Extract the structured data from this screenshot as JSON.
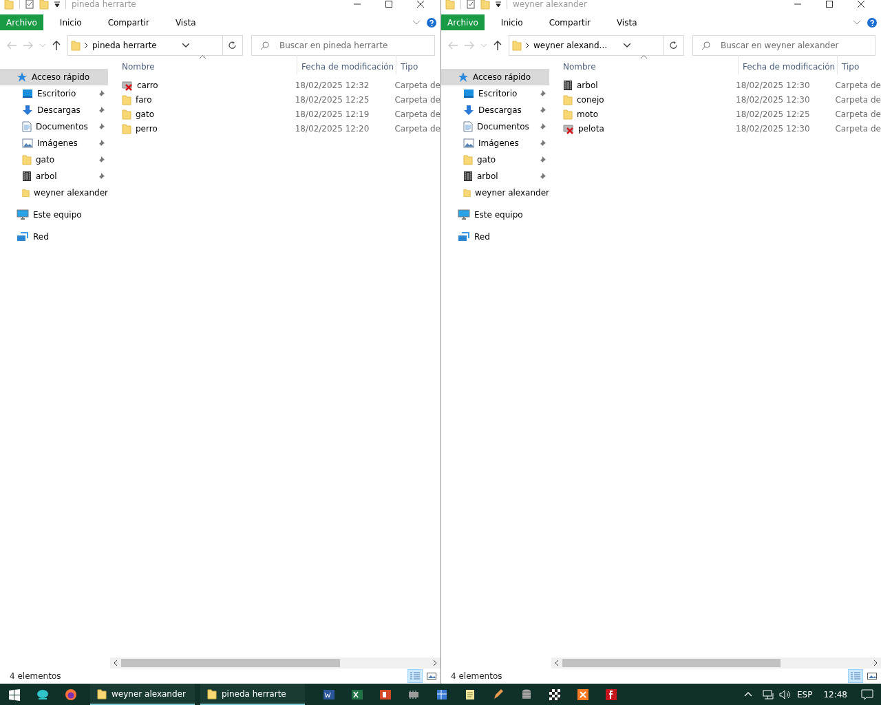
{
  "windows": [
    {
      "title": "pineda herrarte",
      "ribbon_tabs": [
        {
          "label": "Archivo",
          "kind": "file"
        },
        {
          "label": "Inicio",
          "kind": "tab"
        },
        {
          "label": "Compartir",
          "kind": "tab"
        },
        {
          "label": "Vista",
          "kind": "tab"
        }
      ],
      "address": "pineda herrarte",
      "search": {
        "placeholder": "Buscar en pineda herrarte"
      },
      "nav": [
        {
          "label": "Acceso rápido",
          "kind": "star",
          "selected": true,
          "children": [
            {
              "label": "Escritorio",
              "kind": "desktop",
              "pinned": true,
              "selected": false
            },
            {
              "label": "Descargas",
              "kind": "download",
              "pinned": true,
              "selected": false
            },
            {
              "label": "Documentos",
              "kind": "documents",
              "pinned": true,
              "selected": false
            },
            {
              "label": "Imágenes",
              "kind": "pictures",
              "pinned": true,
              "selected": false
            },
            {
              "label": "gato",
              "kind": "folder",
              "pinned": true,
              "selected": false
            },
            {
              "label": "arbol",
              "kind": "film",
              "pinned": true,
              "selected": false
            },
            {
              "label": "weyner alexander",
              "kind": "folder",
              "pinned": false,
              "selected": false
            }
          ]
        },
        {
          "label": "Este equipo",
          "kind": "computer",
          "selected": false
        },
        {
          "label": "Red",
          "kind": "network",
          "selected": false
        }
      ],
      "columns": [
        {
          "label": "Nombre",
          "sorted": true
        },
        {
          "label": "Fecha de modificación",
          "sorted": false
        },
        {
          "label": "Tipo",
          "sorted": false
        }
      ],
      "files": [
        {
          "name": "carro",
          "kind": "folder-x",
          "date": "18/02/2025 12:32",
          "type": "Carpeta de",
          "selected": false
        },
        {
          "name": "faro",
          "kind": "folder",
          "date": "18/02/2025 12:25",
          "type": "Carpeta de",
          "selected": false
        },
        {
          "name": "gato",
          "kind": "folder",
          "date": "18/02/2025 12:19",
          "type": "Carpeta de",
          "selected": false
        },
        {
          "name": "perro",
          "kind": "folder",
          "date": "18/02/2025 12:20",
          "type": "Carpeta de",
          "selected": false
        }
      ],
      "status": "4 elementos",
      "views": [
        {
          "kind": "details",
          "selected": true
        },
        {
          "kind": "tiles",
          "selected": false
        }
      ]
    },
    {
      "title": "weyner alexander",
      "ribbon_tabs": [
        {
          "label": "Archivo",
          "kind": "file"
        },
        {
          "label": "Inicio",
          "kind": "tab"
        },
        {
          "label": "Compartir",
          "kind": "tab"
        },
        {
          "label": "Vista",
          "kind": "tab"
        }
      ],
      "address": "weyner alexand...",
      "search": {
        "placeholder": "Buscar en weyner alexander"
      },
      "nav": [
        {
          "label": "Acceso rápido",
          "kind": "star",
          "selected": true,
          "children": [
            {
              "label": "Escritorio",
              "kind": "desktop",
              "pinned": true,
              "selected": false
            },
            {
              "label": "Descargas",
              "kind": "download",
              "pinned": true,
              "selected": false
            },
            {
              "label": "Documentos",
              "kind": "documents",
              "pinned": true,
              "selected": false
            },
            {
              "label": "Imágenes",
              "kind": "pictures",
              "pinned": true,
              "selected": false
            },
            {
              "label": "gato",
              "kind": "folder",
              "pinned": true,
              "selected": false
            },
            {
              "label": "arbol",
              "kind": "film",
              "pinned": true,
              "selected": false
            },
            {
              "label": "weyner alexander",
              "kind": "folder",
              "pinned": false,
              "selected": false
            }
          ]
        },
        {
          "label": "Este equipo",
          "kind": "computer",
          "selected": false
        },
        {
          "label": "Red",
          "kind": "network",
          "selected": false
        }
      ],
      "columns": [
        {
          "label": "Nombre",
          "sorted": true
        },
        {
          "label": "Fecha de modificación",
          "sorted": false
        },
        {
          "label": "Tipo",
          "sorted": false
        }
      ],
      "files": [
        {
          "name": "arbol",
          "kind": "film",
          "date": "18/02/2025 12:30",
          "type": "Carpeta de",
          "selected": false
        },
        {
          "name": "conejo",
          "kind": "folder",
          "date": "18/02/2025 12:30",
          "type": "Carpeta de",
          "selected": false
        },
        {
          "name": "moto",
          "kind": "folder",
          "date": "18/02/2025 12:25",
          "type": "Carpeta de",
          "selected": false
        },
        {
          "name": "pelota",
          "kind": "folder-x",
          "date": "18/02/2025 12:30",
          "type": "Carpeta de",
          "selected": false
        }
      ],
      "status": "4 elementos",
      "views": [
        {
          "kind": "details",
          "selected": true
        },
        {
          "kind": "tiles",
          "selected": false
        }
      ]
    }
  ],
  "taskbar": {
    "windows": [
      {
        "label": "weyner alexander"
      },
      {
        "label": "pineda herrarte"
      }
    ],
    "language": "ESP",
    "clock": "12:48"
  }
}
